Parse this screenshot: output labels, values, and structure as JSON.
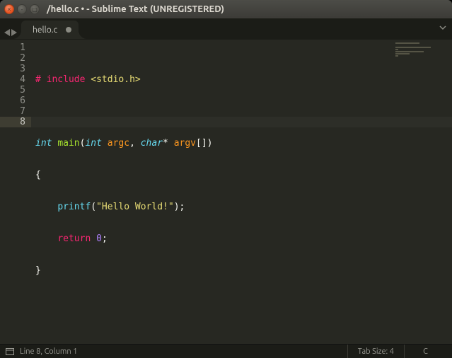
{
  "window": {
    "title": "/hello.c • - Sublime Text (UNREGISTERED)"
  },
  "tabs": [
    {
      "label": "hello.c",
      "dirty": true
    }
  ],
  "gutter": {
    "lines": [
      "1",
      "2",
      "3",
      "4",
      "5",
      "6",
      "7",
      "8"
    ],
    "active": 8
  },
  "code": {
    "l1": {
      "hash": "#",
      "include": " include ",
      "hdr": "<stdio.h>"
    },
    "l3": {
      "int": "int",
      "sp": " ",
      "main": "main",
      "op": "(",
      "int2": "int",
      "sp2": " ",
      "argc": "argc",
      "comma": ", ",
      "char": "char",
      "star": "* ",
      "argv": "argv",
      "br": "[])"
    },
    "l4": {
      "open": "{"
    },
    "l5": {
      "indent": "    ",
      "printf": "printf",
      "op": "(",
      "str": "\"Hello World!\"",
      "cl": ");"
    },
    "l6": {
      "indent": "    ",
      "return": "return",
      "sp": " ",
      "zero": "0",
      "semi": ";"
    },
    "l7": {
      "close": "}"
    }
  },
  "status": {
    "position": "Line 8, Column 1",
    "tabsize": "Tab Size: 4",
    "syntax": "C"
  }
}
